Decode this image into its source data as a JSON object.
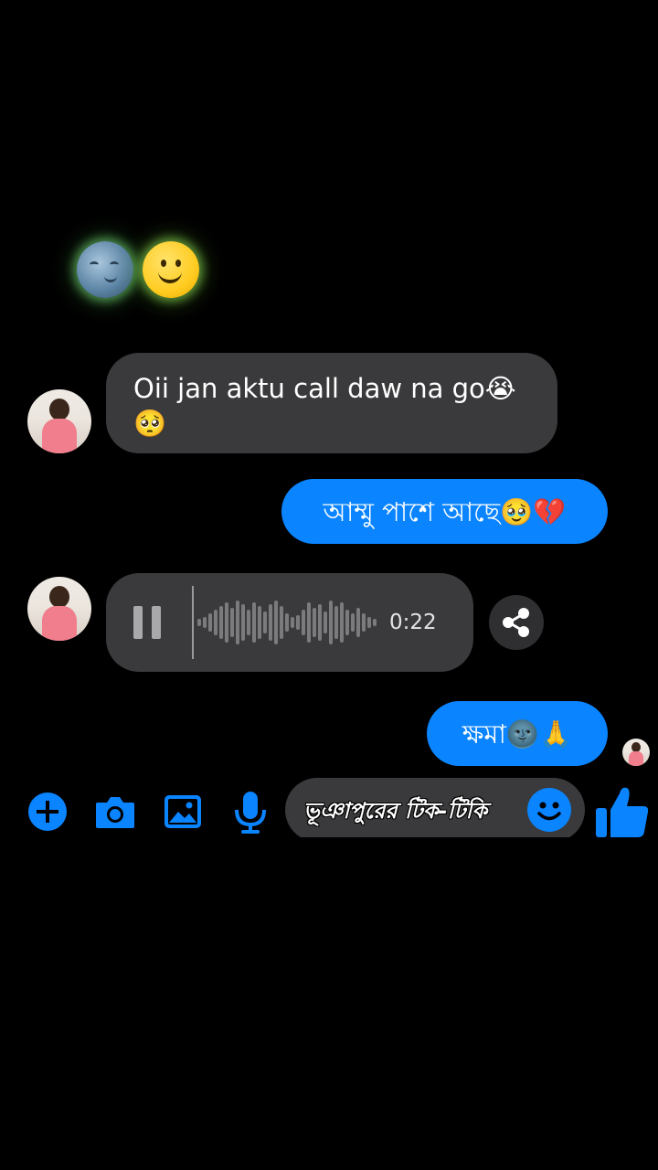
{
  "colors": {
    "background": "#000000",
    "incoming_bubble": "#3a3a3c",
    "outgoing_bubble": "#0a84ff",
    "accent": "#0a84ff"
  },
  "reactions": [
    {
      "icon": "new-moon-face-icon"
    },
    {
      "icon": "slightly-smiling-face-icon"
    }
  ],
  "messages": [
    {
      "direction": "incoming",
      "text": "Oii jan aktu call daw na go😭🥺"
    },
    {
      "direction": "outgoing",
      "text": "আম্মু পাশে আছে🥹💔"
    },
    {
      "direction": "incoming",
      "type": "voice",
      "duration": "0:22"
    },
    {
      "direction": "outgoing",
      "text": "ক্ষমা🌚🙏"
    }
  ],
  "composer": {
    "text": "ভূঞাপুরের টিক-টিকি",
    "icons": [
      "plus-icon",
      "camera-icon",
      "gallery-icon",
      "microphone-icon",
      "emoji-icon",
      "thumbs-up-icon"
    ]
  }
}
